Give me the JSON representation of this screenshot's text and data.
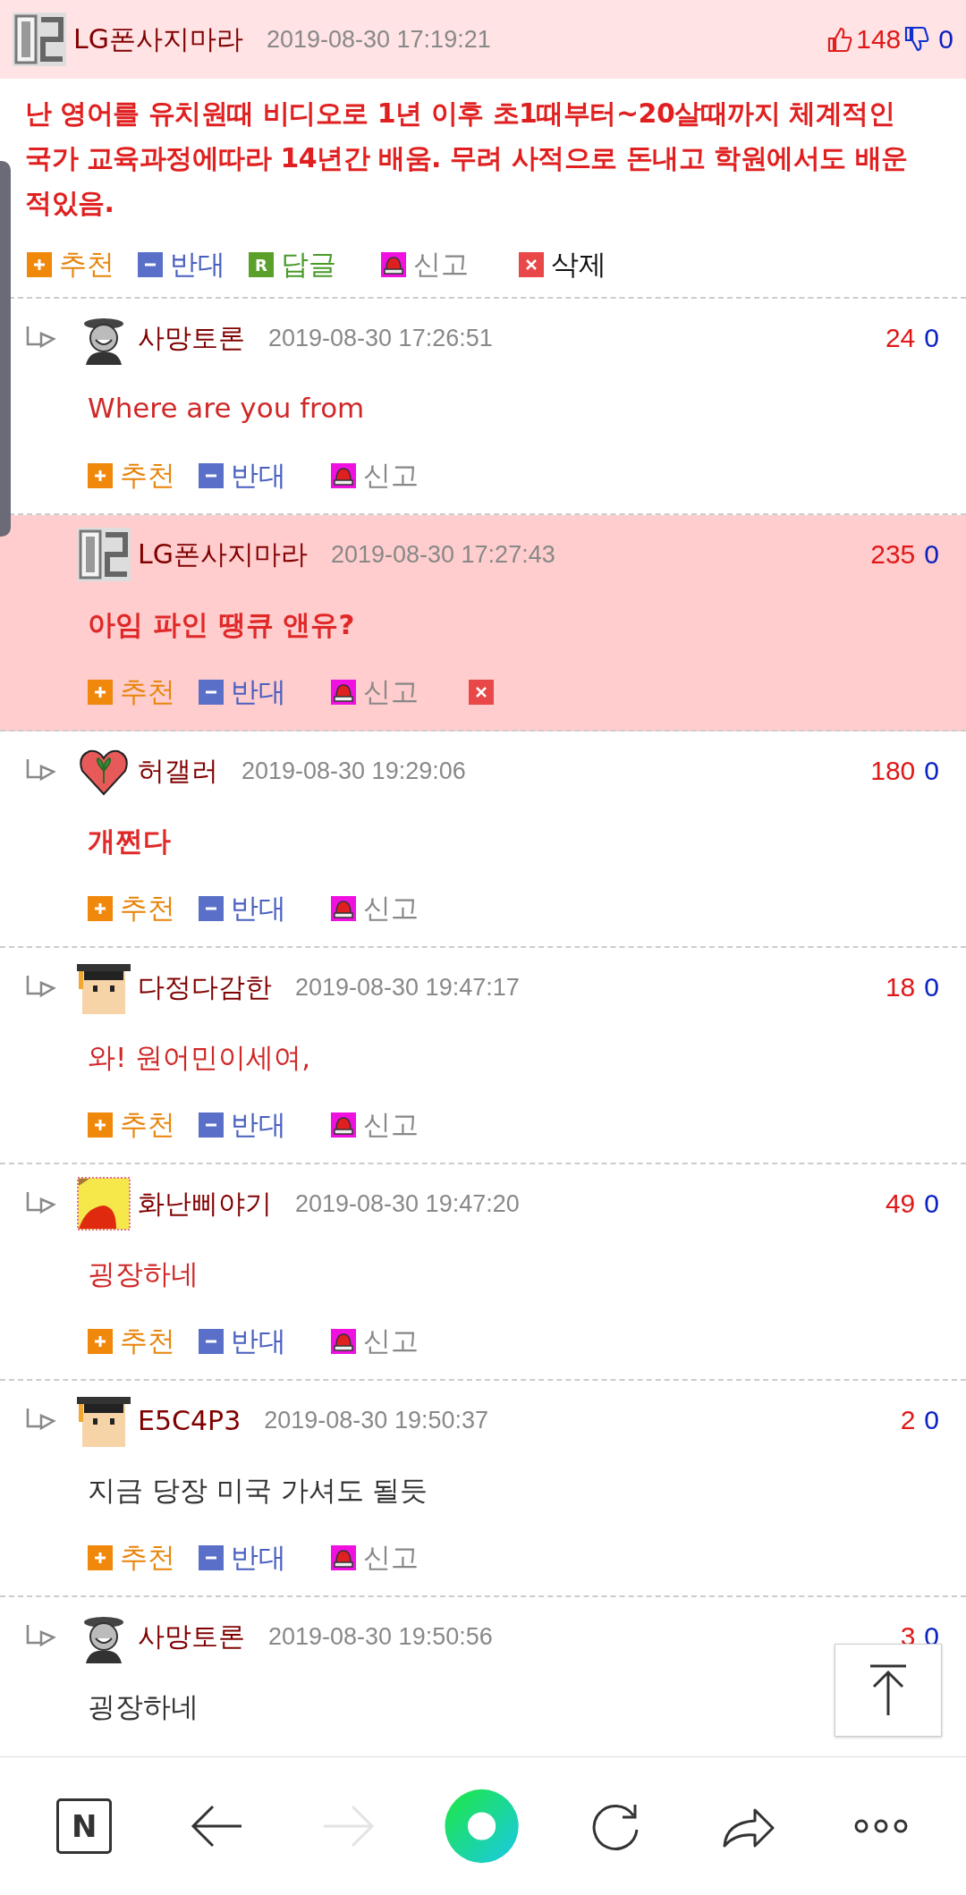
{
  "post": {
    "avatar": {
      "kind": "grid"
    },
    "author": "LG폰사지마라",
    "date": "2019-08-30 17:19:21",
    "up": "148",
    "down": "0",
    "text": "난 영어를 유치원때 비디오로 1년 이후 초1때부터~20살때까지 체계적인 국가 교육과정에따라 14년간 배움. 무려 사적으로 돈내고 학원에서도 배운적있음.",
    "actions": [
      {
        "kind": "recommend",
        "label": "추천"
      },
      {
        "kind": "oppose",
        "label": "반대"
      },
      {
        "kind": "reply",
        "badge": "R",
        "label": "답글"
      },
      {
        "kind": "report",
        "label": "신고"
      },
      {
        "kind": "delete",
        "label": "삭제"
      }
    ]
  },
  "comments": [
    {
      "avatar": {
        "kind": "mascot"
      },
      "author": "사망토론",
      "date": "2019-08-30 17:26:51",
      "up": "24",
      "down": "0",
      "text": "Where are you from",
      "color": "#d02828",
      "bold": false,
      "highlighted": false,
      "reply_arrow": true,
      "actions": [
        {
          "kind": "recommend",
          "label": "추천"
        },
        {
          "kind": "oppose",
          "label": "반대"
        },
        {
          "kind": "report",
          "label": "신고"
        }
      ]
    },
    {
      "avatar": {
        "kind": "grid"
      },
      "author": "LG폰사지마라",
      "date": "2019-08-30 17:27:43",
      "up": "235",
      "down": "0",
      "text": "아임 파인 땡큐 앤유?",
      "color": "#e02828",
      "bold": true,
      "highlighted": true,
      "reply_arrow": false,
      "actions": [
        {
          "kind": "recommend",
          "label": "추천"
        },
        {
          "kind": "oppose",
          "label": "반대"
        },
        {
          "kind": "report",
          "label": "신고"
        },
        {
          "kind": "delete"
        }
      ]
    },
    {
      "avatar": {
        "kind": "heart"
      },
      "author": "허갤러",
      "date": "2019-08-30 19:29:06",
      "up": "180",
      "down": "0",
      "text": "개쩐다",
      "color": "#e02828",
      "bold": true,
      "highlighted": false,
      "reply_arrow": true,
      "actions": [
        {
          "kind": "recommend",
          "label": "추천"
        },
        {
          "kind": "oppose",
          "label": "반대"
        },
        {
          "kind": "report",
          "label": "신고"
        }
      ]
    },
    {
      "avatar": {
        "kind": "student"
      },
      "author": "다정다감한",
      "date": "2019-08-30 19:47:17",
      "up": "18",
      "down": "0",
      "text": "와! 원어민이세여,",
      "color": "#d02828",
      "bold": false,
      "highlighted": false,
      "reply_arrow": true,
      "actions": [
        {
          "kind": "recommend",
          "label": "추천"
        },
        {
          "kind": "oppose",
          "label": "반대"
        },
        {
          "kind": "report",
          "label": "신고"
        }
      ]
    },
    {
      "avatar": {
        "kind": "yellow"
      },
      "author": "화난삐야기",
      "date": "2019-08-30 19:47:20",
      "up": "49",
      "down": "0",
      "text": "굉장하네",
      "color": "#d02828",
      "bold": false,
      "highlighted": false,
      "reply_arrow": true,
      "actions": [
        {
          "kind": "recommend",
          "label": "추천"
        },
        {
          "kind": "oppose",
          "label": "반대"
        },
        {
          "kind": "report",
          "label": "신고"
        }
      ]
    },
    {
      "avatar": {
        "kind": "student"
      },
      "author": "E5C4P3",
      "date": "2019-08-30 19:50:37",
      "up": "2",
      "down": "0",
      "text": "지금 당장 미국 가셔도 될듯",
      "color": "#333333",
      "bold": false,
      "highlighted": false,
      "reply_arrow": true,
      "actions": [
        {
          "kind": "recommend",
          "label": "추천"
        },
        {
          "kind": "oppose",
          "label": "반대"
        },
        {
          "kind": "report",
          "label": "신고"
        }
      ]
    },
    {
      "avatar": {
        "kind": "mascot"
      },
      "author": "사망토론",
      "date": "2019-08-30 19:50:56",
      "up": "3",
      "down": "0",
      "text": "굉장하네",
      "color": "#333333",
      "bold": false,
      "highlighted": false,
      "reply_arrow": true
    }
  ],
  "nav": [
    {
      "kind": "naver",
      "label": "N",
      "disabled": false
    },
    {
      "kind": "back",
      "disabled": false
    },
    {
      "kind": "forward",
      "disabled": true
    },
    {
      "kind": "home",
      "disabled": false
    },
    {
      "kind": "refresh",
      "disabled": false
    },
    {
      "kind": "share",
      "disabled": false
    },
    {
      "kind": "more",
      "disabled": false
    }
  ]
}
